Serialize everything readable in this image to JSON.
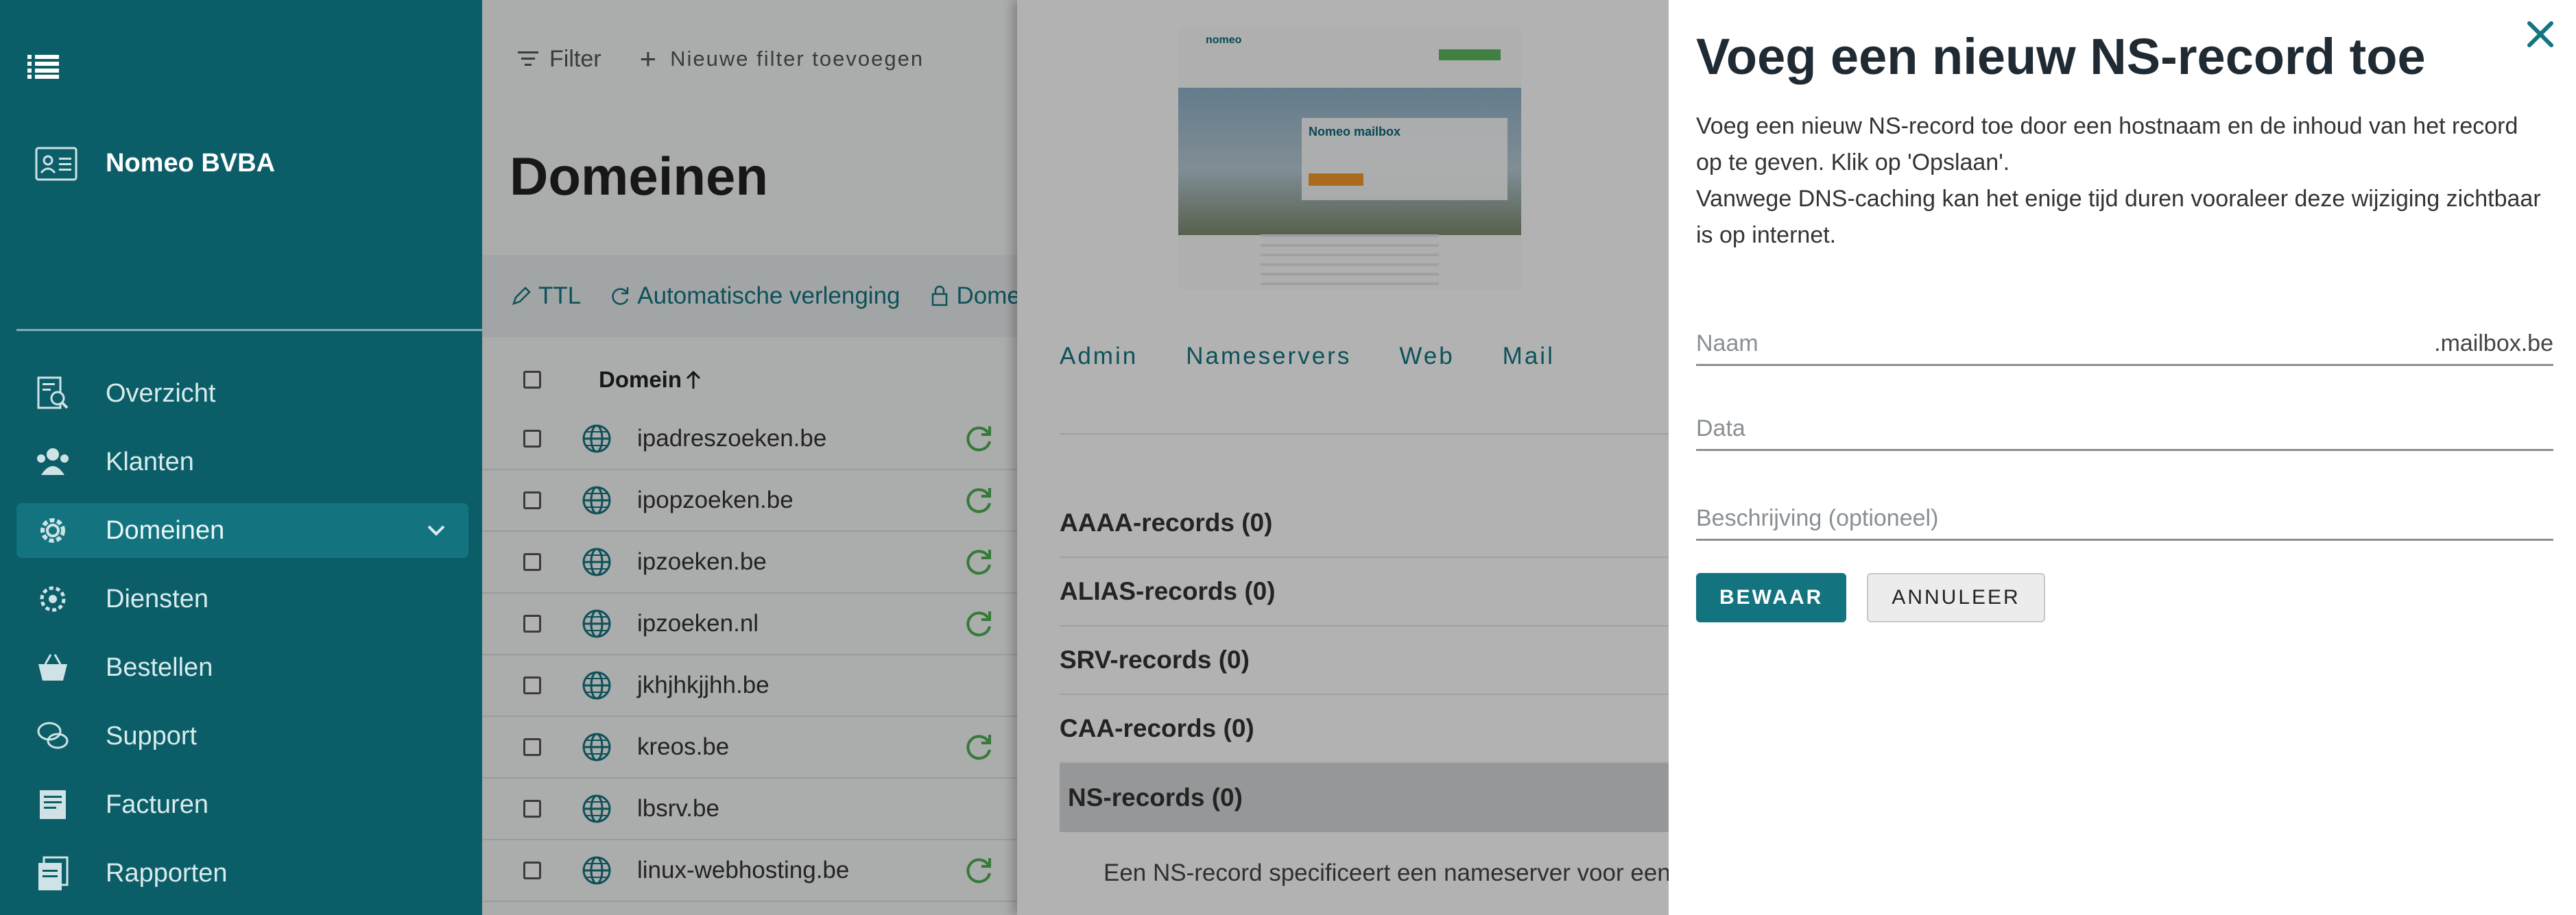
{
  "sidebar": {
    "company": "Nomeo BVBA",
    "items": [
      {
        "label": "Overzicht",
        "icon": "report-search-icon"
      },
      {
        "label": "Klanten",
        "icon": "users-icon"
      },
      {
        "label": "Domeinen",
        "icon": "gear-icon"
      },
      {
        "label": "Diensten",
        "icon": "gear-settings-icon"
      },
      {
        "label": "Bestellen",
        "icon": "basket-icon"
      },
      {
        "label": "Support",
        "icon": "chat-icon"
      },
      {
        "label": "Facturen",
        "icon": "invoice-icon"
      },
      {
        "label": "Rapporten",
        "icon": "reports-icon"
      }
    ],
    "active_item": "Domeinen"
  },
  "list": {
    "filter_label": "Filter",
    "add_filter_label": "Nieuwe filter toevoegen",
    "title": "Domeinen",
    "actions": {
      "ttl": "TTL",
      "auto_renew": "Automatische verlenging",
      "domains": "Dome"
    },
    "column_domain": "Domein",
    "rows": [
      {
        "name": "ipadreszoeken.be",
        "auto_renew": true
      },
      {
        "name": "ipopzoeken.be",
        "auto_renew": true
      },
      {
        "name": "ipzoeken.be",
        "auto_renew": true
      },
      {
        "name": "ipzoeken.nl",
        "auto_renew": true
      },
      {
        "name": "jkhjhkjjhh.be",
        "auto_renew": false
      },
      {
        "name": "kreos.be",
        "auto_renew": true
      },
      {
        "name": "lbsrv.be",
        "auto_renew": false
      },
      {
        "name": "linux-webhosting.be",
        "auto_renew": true
      }
    ]
  },
  "detail": {
    "preview": {
      "logo": "nomeo",
      "card_title": "Nomeo mailbox"
    },
    "tabs": [
      "Admin",
      "Nameservers",
      "Web",
      "Mail"
    ],
    "records": [
      {
        "label": "AAAA-records (0)",
        "active": false
      },
      {
        "label": "ALIAS-records (0)",
        "active": false
      },
      {
        "label": "SRV-records (0)",
        "active": false
      },
      {
        "label": "CAA-records (0)",
        "active": false
      },
      {
        "label": "NS-records (0)",
        "active": true
      }
    ],
    "ns_description": "Een NS-record specificeert een nameserver voor een d"
  },
  "drawer": {
    "title": "Voeg een nieuw NS-record toe",
    "description_line1": "Voeg een nieuw NS-record toe door een hostnaam en de inhoud van het record op te geven. Klik op 'Opslaan'.",
    "description_line2": "Vanwege DNS-caching kan het enige tijd duren vooraleer deze wijziging zichtbaar is op internet.",
    "fields": {
      "name_placeholder": "Naam",
      "name_suffix": ".mailbox.be",
      "data_placeholder": "Data",
      "description_placeholder": "Beschrijving (optioneel)"
    },
    "save_label": "BEWAAR",
    "cancel_label": "ANNULEER"
  },
  "colors": {
    "sidebar_bg": "#0b5e68",
    "accent": "#137480",
    "renew_green": "#4caf50"
  }
}
